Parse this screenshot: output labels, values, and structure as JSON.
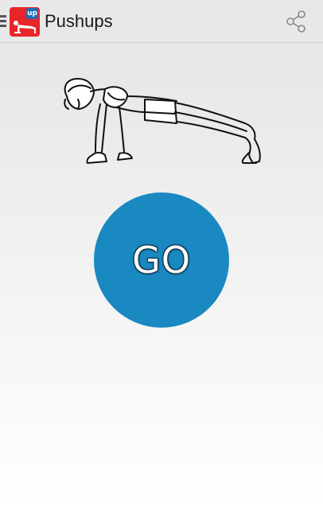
{
  "action_bar": {
    "title": "Pushups",
    "app_icon": {
      "name": "pushup-app-icon",
      "badge_text": "up",
      "color": "#e8262a",
      "badge_color": "#1e6db4"
    },
    "drawer_icon": "menu-icon",
    "share_icon": "share-icon"
  },
  "main": {
    "illustration": "pushup-plank-illustration",
    "go_button": {
      "label": "GO",
      "color": "#1a88c1"
    }
  }
}
